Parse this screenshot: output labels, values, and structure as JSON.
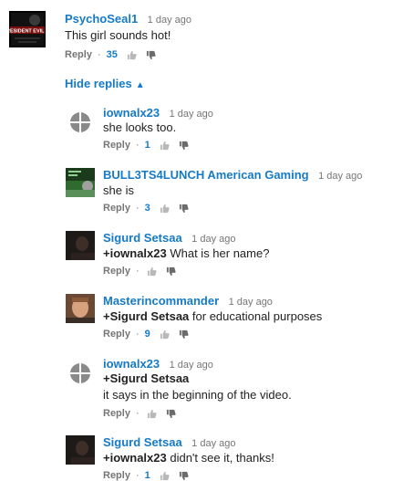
{
  "comment": {
    "author": "PsychoSeal1",
    "time": "1 day ago",
    "text": "This girl sounds hot!",
    "reply_label": "Reply",
    "likes": "35",
    "avatar_logo_text": "RESIDENT EVIL 3"
  },
  "hide_replies_label": "Hide replies",
  "replies": [
    {
      "author": "iownalx23",
      "time": "1 day ago",
      "text": "she looks too.",
      "reply_label": "Reply",
      "likes": "1"
    },
    {
      "author": "BULL3TS4LUNCH American Gaming",
      "time": "1 day ago",
      "text": "she is",
      "reply_label": "Reply",
      "likes": "3"
    },
    {
      "author": "Sigurd Setsaa",
      "time": "1 day ago",
      "mention": "+iownalx23",
      "text": " What is her name?",
      "reply_label": "Reply",
      "likes": ""
    },
    {
      "author": "Masterincommander",
      "time": "1 day ago",
      "mention": "+Sigurd Setsaa",
      "text": " for educational purposes",
      "reply_label": "Reply",
      "likes": "9"
    },
    {
      "author": "iownalx23",
      "time": "1 day ago",
      "mention": "+Sigurd Setsaa",
      "text2": "it says in the beginning of the video.",
      "reply_label": "Reply",
      "likes": ""
    },
    {
      "author": "Sigurd Setsaa",
      "time": "1 day ago",
      "mention": "+iownalx23",
      "text": " didn't see it, thanks!",
      "reply_label": "Reply",
      "likes": "1"
    }
  ],
  "colors": {
    "link": "#167ac6",
    "meta": "#767676",
    "text": "#222222"
  },
  "icons": {
    "like": "thumbs-up-icon",
    "dislike": "thumbs-down-icon",
    "collapse": "chevron-up-icon"
  }
}
